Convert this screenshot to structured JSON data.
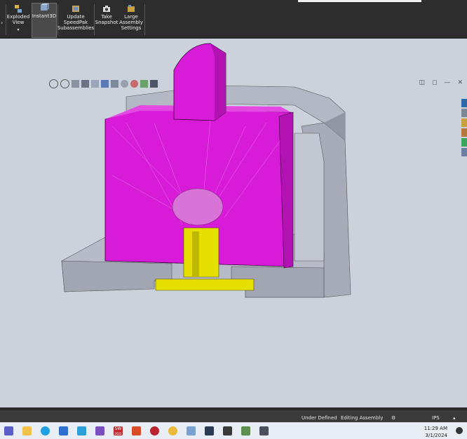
{
  "ribbon": {
    "items": [
      {
        "label": "Exploded View",
        "lines": [
          "Exploded",
          "View"
        ]
      },
      {
        "label": "Instant3D",
        "lines": [
          "Instant3D"
        ]
      },
      {
        "label": "Update SpeedPak Subassemblies",
        "lines": [
          "Update",
          "SpeedPak",
          "Subassemblies"
        ]
      },
      {
        "label": "Take Snapshot",
        "lines": [
          "Take",
          "Snapshot"
        ]
      },
      {
        "label": "Large Assembly Settings",
        "lines": [
          "Large",
          "Assembly",
          "Settings"
        ]
      }
    ],
    "colors": {
      "background": "#2d2d2d",
      "text": "#f0f0f0"
    }
  },
  "viewport": {
    "background": "#ccd2dc",
    "part_colors": {
      "housing": "#b4b8c4",
      "knob": "#d81bd8",
      "pin": "#e6e000"
    }
  },
  "statusbar": {
    "state": "Under Defined",
    "mode": "Editing Assembly",
    "units": "IPS"
  },
  "taskbar": {
    "time": "11:29 AM",
    "date": "3/1/2024",
    "sw_badge": "SW",
    "sw_year": "2022"
  }
}
